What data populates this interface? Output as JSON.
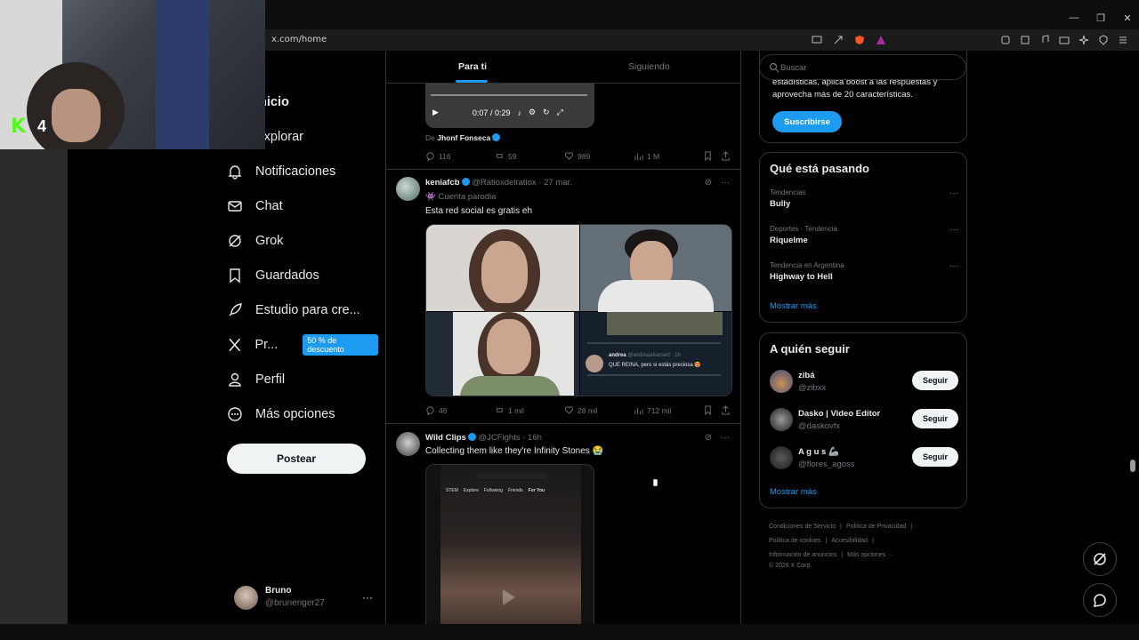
{
  "browser": {
    "url": "x.com/home"
  },
  "stream_overlay": {
    "platform_badge": "K",
    "count": "4"
  },
  "nav": {
    "items": [
      {
        "label": "Inicio",
        "icon": "home-icon"
      },
      {
        "label": "Explorar",
        "icon": "search-icon"
      },
      {
        "label": "Notificaciones",
        "icon": "bell-icon"
      },
      {
        "label": "Chat",
        "icon": "mail-icon"
      },
      {
        "label": "Grok",
        "icon": "grok-icon"
      },
      {
        "label": "Guardados",
        "icon": "bookmark-icon"
      },
      {
        "label": "Estudio para cre...",
        "icon": "rocket-icon"
      },
      {
        "label": "Pr...",
        "icon": "x-logo-icon",
        "badge": "50 % de descuento"
      },
      {
        "label": "Perfil",
        "icon": "person-icon"
      },
      {
        "label": "Más opciones",
        "icon": "more-circle-icon"
      }
    ],
    "post_button": "Postear",
    "account": {
      "name": "Bruno",
      "handle": "@brunenger27",
      "more": "···"
    }
  },
  "feed": {
    "tabs": [
      {
        "label": "Para ti",
        "active": true
      },
      {
        "label": "Siguiendo",
        "active": false
      }
    ],
    "video1": {
      "time": "0:07 / 0:29",
      "from_prefix": "De",
      "from_name": "Jhonf Fonseca",
      "replies": "116",
      "reposts": "59",
      "likes": "989",
      "views": "1 M"
    },
    "tweet1": {
      "name": "keniafcb",
      "handle": "@Ratioxdelratiox",
      "time": "· 27 mar.",
      "parody": "Cuenta parodia",
      "text": "Esta red social es gratis eh",
      "embedded": {
        "user": "andrea",
        "handle": "@andreaalvarsed · 1h",
        "text": "QUE REINA, pero si estás preciosa 😍"
      },
      "replies": "46",
      "reposts": "1 mil",
      "likes": "28 mil",
      "views": "712 mil"
    },
    "tweet2": {
      "name": "Wild Clips",
      "handle": "@JCFights",
      "time": "· 16h",
      "text": "Collecting them like they're Infinity Stones 😭",
      "video_nav": [
        "STEM",
        "Explore",
        "Following",
        "Friends",
        "For You"
      ]
    }
  },
  "right": {
    "search_placeholder": "Buscar",
    "premium": {
      "text": "estadísticas, aplica boost a las respuestas y aprovecha más de 20 características.",
      "button": "Suscribirse"
    },
    "trends": {
      "title": "Qué está pasando",
      "items": [
        {
          "meta": "Tendencias",
          "name": "Bully"
        },
        {
          "meta": "Deportes · Tendencia",
          "name": "Riquelme"
        },
        {
          "meta": "Tendencia en Argentina",
          "name": "Highway to Hell"
        }
      ],
      "show_more": "Mostrar más"
    },
    "who_to_follow": {
      "title": "A quién seguir",
      "items": [
        {
          "name": "zibá",
          "handle": "@zibxx",
          "button": "Seguir"
        },
        {
          "name": "Dasko | Video Editor",
          "handle": "@daskovfx",
          "button": "Seguir"
        },
        {
          "name": "A g u s 🦾",
          "handle": "@flores_agoss",
          "button": "Seguir"
        }
      ],
      "show_more": "Mostrar más"
    },
    "footer": {
      "links": [
        "Condiciones de Servicio",
        "Política de Privacidad",
        "Política de cookies",
        "Accesibilidad",
        "Información de anuncios",
        "Más opciones ···"
      ],
      "copyright": "© 2026 X Corp."
    }
  },
  "colors": {
    "accent": "#1d9bf0",
    "background": "#000000",
    "border": "#2f3336",
    "muted_text": "#71767b",
    "kick_green": "#53fc18"
  }
}
